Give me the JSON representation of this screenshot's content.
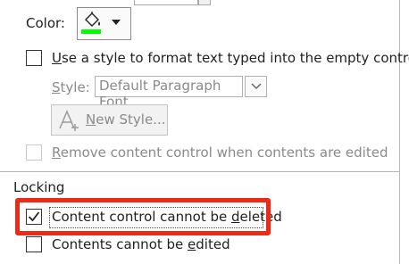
{
  "color": {
    "label": "Color:",
    "swatch": "#00ff00",
    "icon": "paint-bucket-icon"
  },
  "use_style": {
    "label_u": "U",
    "label_rest": "se a style to format text typed into the empty control",
    "checked": false
  },
  "style": {
    "label_u": "S",
    "label_rest": "tyle:",
    "value": "Default Paragraph Font"
  },
  "new_style": {
    "label_u": "N",
    "label_rest": "ew Style..."
  },
  "remove": {
    "label_u": "R",
    "label_rest": "emove content control when contents are edited",
    "checked": false
  },
  "locking": {
    "title": "Locking",
    "cannot_delete": {
      "label_pre": "Content control cannot be ",
      "label_u": "d",
      "label_post": "eleted",
      "checked": true
    },
    "cannot_edit": {
      "label_pre": "Contents cannot be ",
      "label_u": "e",
      "label_post": "dited",
      "checked": false
    }
  },
  "colors": {
    "highlight": "#ee2a16"
  }
}
